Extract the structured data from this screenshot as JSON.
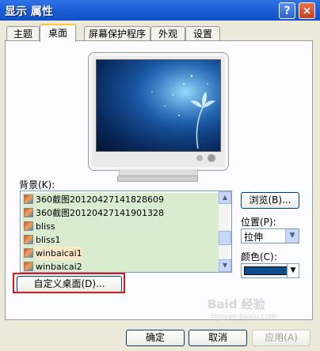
{
  "window": {
    "title": "显示 属性",
    "help_label": "?",
    "close_label": "×"
  },
  "tabs": [
    {
      "label": "主题"
    },
    {
      "label": "桌面"
    },
    {
      "label": "屏幕保护程序"
    },
    {
      "label": "外观"
    },
    {
      "label": "设置"
    }
  ],
  "background_label": "背景(K):",
  "background_list": [
    {
      "label": "360截图20120427141828609"
    },
    {
      "label": "360截图20120427141901328"
    },
    {
      "label": "bliss"
    },
    {
      "label": "bliss1"
    },
    {
      "label": "winbaicai1"
    },
    {
      "label": "winbaicai2"
    }
  ],
  "browse_button": "浏览(B)...",
  "position": {
    "label": "位置(P):",
    "value": "拉伸"
  },
  "color": {
    "label": "颜色(C):",
    "value": "#0f4e8c"
  },
  "customize_button": "自定义桌面(D)...",
  "footer": {
    "ok": "确定",
    "cancel": "取消",
    "apply": "应用(A)"
  },
  "watermark": {
    "text": "Baid 经验",
    "sub": "jingyan.baidu.com"
  }
}
